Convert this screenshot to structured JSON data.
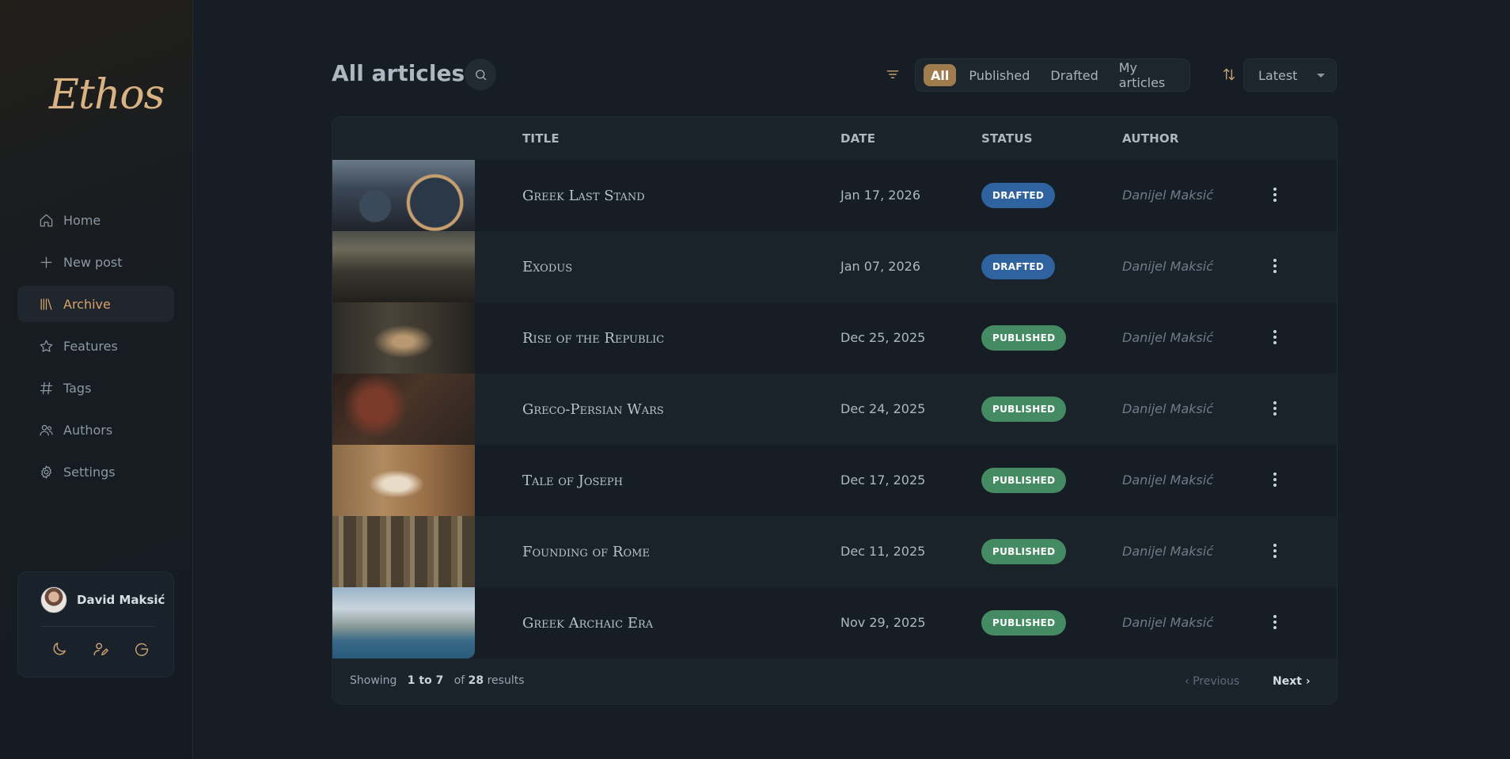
{
  "app": {
    "logo": "Ethos"
  },
  "sidebar": {
    "items": [
      {
        "label": "Home",
        "icon": "home-icon",
        "active": false
      },
      {
        "label": "New post",
        "icon": "plus-icon",
        "active": false
      },
      {
        "label": "Archive",
        "icon": "library-icon",
        "active": true
      },
      {
        "label": "Features",
        "icon": "star-icon",
        "active": false
      },
      {
        "label": "Tags",
        "icon": "hash-icon",
        "active": false
      },
      {
        "label": "Authors",
        "icon": "users-icon",
        "active": false
      },
      {
        "label": "Settings",
        "icon": "gear-icon",
        "active": false
      }
    ],
    "user": {
      "name": "David Maksić"
    }
  },
  "header": {
    "title": "All articles",
    "filters": [
      "All",
      "Published",
      "Drafted",
      "My articles"
    ],
    "active_filter": "All",
    "sort": "Latest"
  },
  "table": {
    "columns": [
      "TITLE",
      "DATE",
      "STATUS",
      "AUTHOR"
    ],
    "rows": [
      {
        "title": "Greek Last Stand",
        "date": "Jan 17, 2026",
        "status": "DRAFTED",
        "author": "Danijel Maksić"
      },
      {
        "title": "Exodus",
        "date": "Jan 07, 2026",
        "status": "DRAFTED",
        "author": "Danijel Maksić"
      },
      {
        "title": "Rise of the Republic",
        "date": "Dec 25, 2025",
        "status": "PUBLISHED",
        "author": "Danijel Maksić"
      },
      {
        "title": "Greco-Persian Wars",
        "date": "Dec 24, 2025",
        "status": "PUBLISHED",
        "author": "Danijel Maksić"
      },
      {
        "title": "Tale of Joseph",
        "date": "Dec 17, 2025",
        "status": "PUBLISHED",
        "author": "Danijel Maksić"
      },
      {
        "title": "Founding of Rome",
        "date": "Dec 11, 2025",
        "status": "PUBLISHED",
        "author": "Danijel Maksić"
      },
      {
        "title": "Greek Archaic Era",
        "date": "Nov 29, 2025",
        "status": "PUBLISHED",
        "author": "Danijel Maksić"
      }
    ]
  },
  "footer": {
    "showing_prefix": "Showing",
    "range": "1 to 7",
    "of_label": "of",
    "total": "28",
    "results_label": "results",
    "prev_label": "Previous",
    "next_label": "Next"
  },
  "colors": {
    "accent": "#d9a26a",
    "drafted": "#2f63a0",
    "published": "#448a62"
  }
}
